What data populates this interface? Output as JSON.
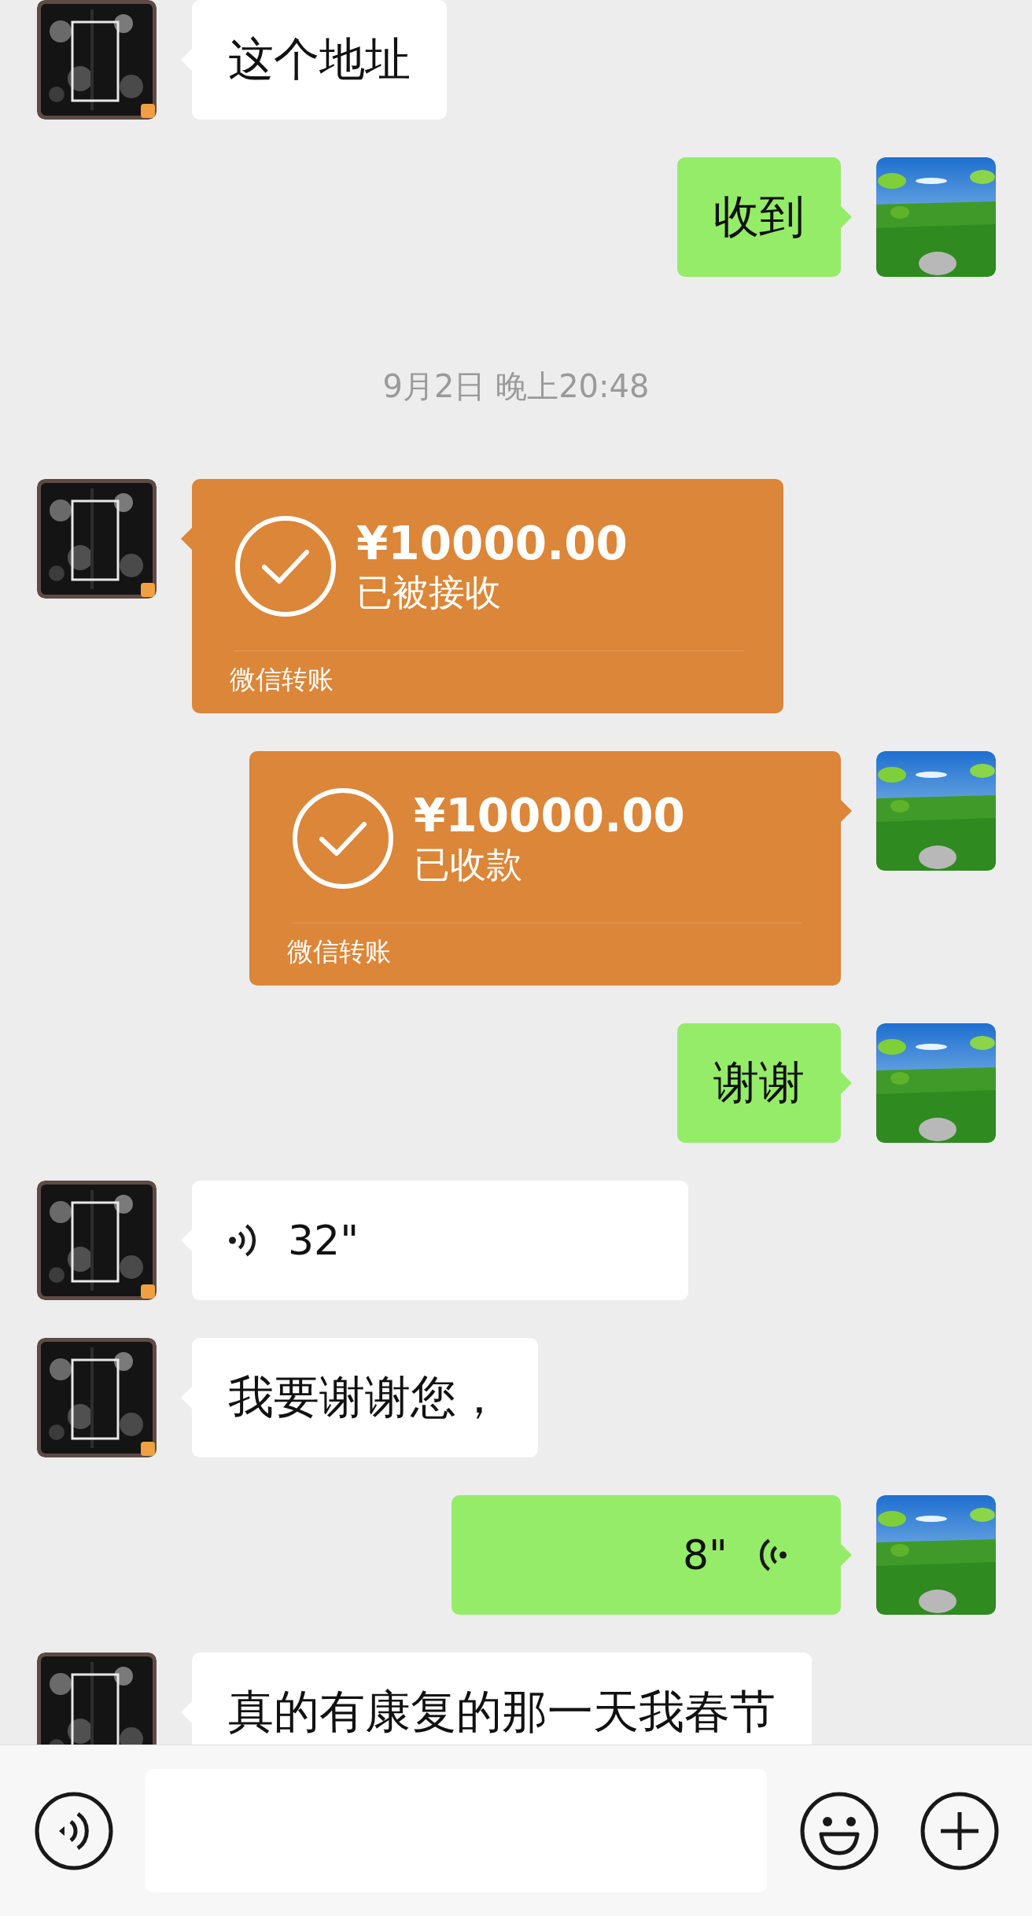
{
  "messages": [
    {
      "kind": "text",
      "outgoing": false,
      "text": "这个地址"
    },
    {
      "kind": "text",
      "outgoing": true,
      "text": "收到"
    },
    {
      "kind": "time",
      "text": "9月2日 晚上20:48"
    },
    {
      "kind": "transfer",
      "outgoing": false,
      "amount": "¥10000.00",
      "status": "已被接收",
      "footer": "微信转账"
    },
    {
      "kind": "transfer",
      "outgoing": true,
      "amount": "¥10000.00",
      "status": "已收款",
      "footer": "微信转账"
    },
    {
      "kind": "text",
      "outgoing": true,
      "text": "谢谢"
    },
    {
      "kind": "voice",
      "outgoing": false,
      "duration": "32\""
    },
    {
      "kind": "text",
      "outgoing": false,
      "text": "我要谢谢您，"
    },
    {
      "kind": "voice",
      "outgoing": true,
      "duration": "8\""
    },
    {
      "kind": "text",
      "outgoing": false,
      "text": "真的有康复的那一天我春节"
    }
  ]
}
